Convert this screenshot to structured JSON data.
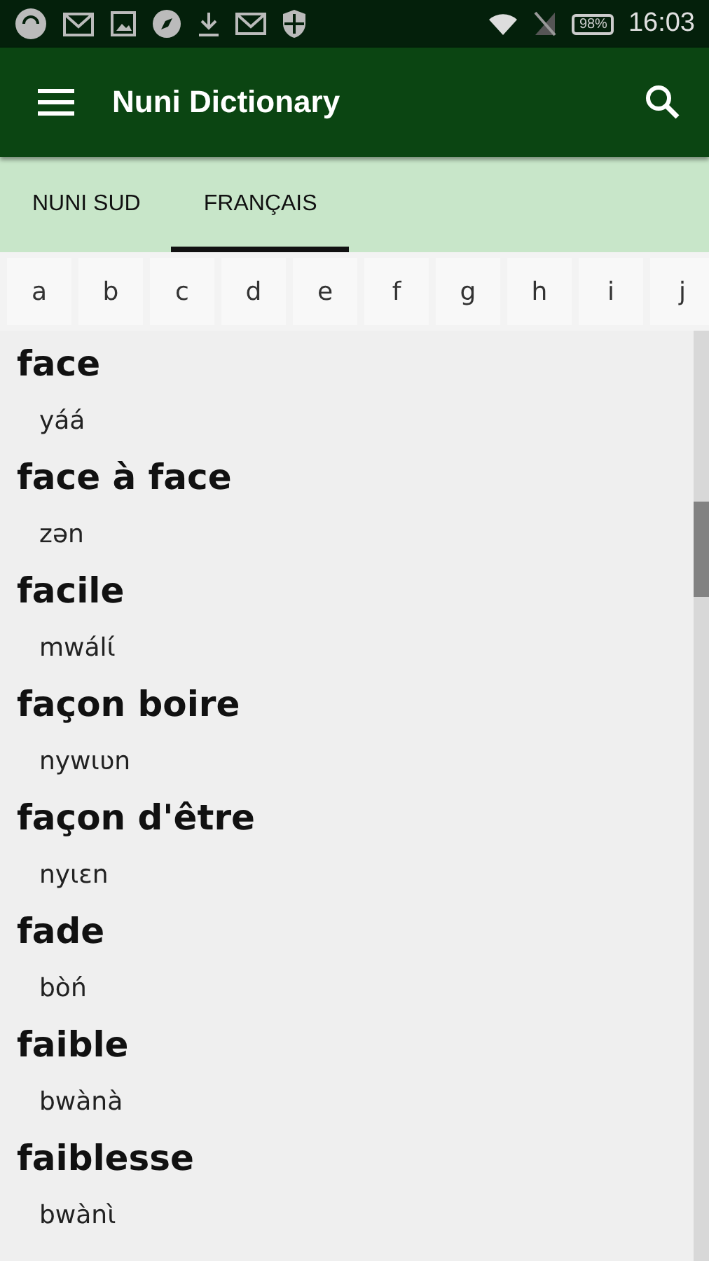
{
  "status_bar": {
    "battery": "98%",
    "time": "16:03"
  },
  "app_bar": {
    "title": "Nuni Dictionary"
  },
  "tabs": [
    {
      "label": "NUNI SUD",
      "selected": false
    },
    {
      "label": "FRANÇAIS",
      "selected": true
    }
  ],
  "letters": [
    "a",
    "b",
    "c",
    "d",
    "e",
    "f",
    "g",
    "h",
    "i",
    "j"
  ],
  "entries": [
    {
      "word": "face",
      "translation": "yáá"
    },
    {
      "word": "face à face",
      "translation": "zən"
    },
    {
      "word": "facile",
      "translation": "mwálɩ́"
    },
    {
      "word": "façon boire",
      "translation": "nywɩʋn"
    },
    {
      "word": "façon d'être",
      "translation": "nyɩɛn"
    },
    {
      "word": "fade",
      "translation": "bòń"
    },
    {
      "word": "faible",
      "translation": "bwànà"
    },
    {
      "word": "faiblesse",
      "translation": "bwànɩ̀"
    }
  ]
}
